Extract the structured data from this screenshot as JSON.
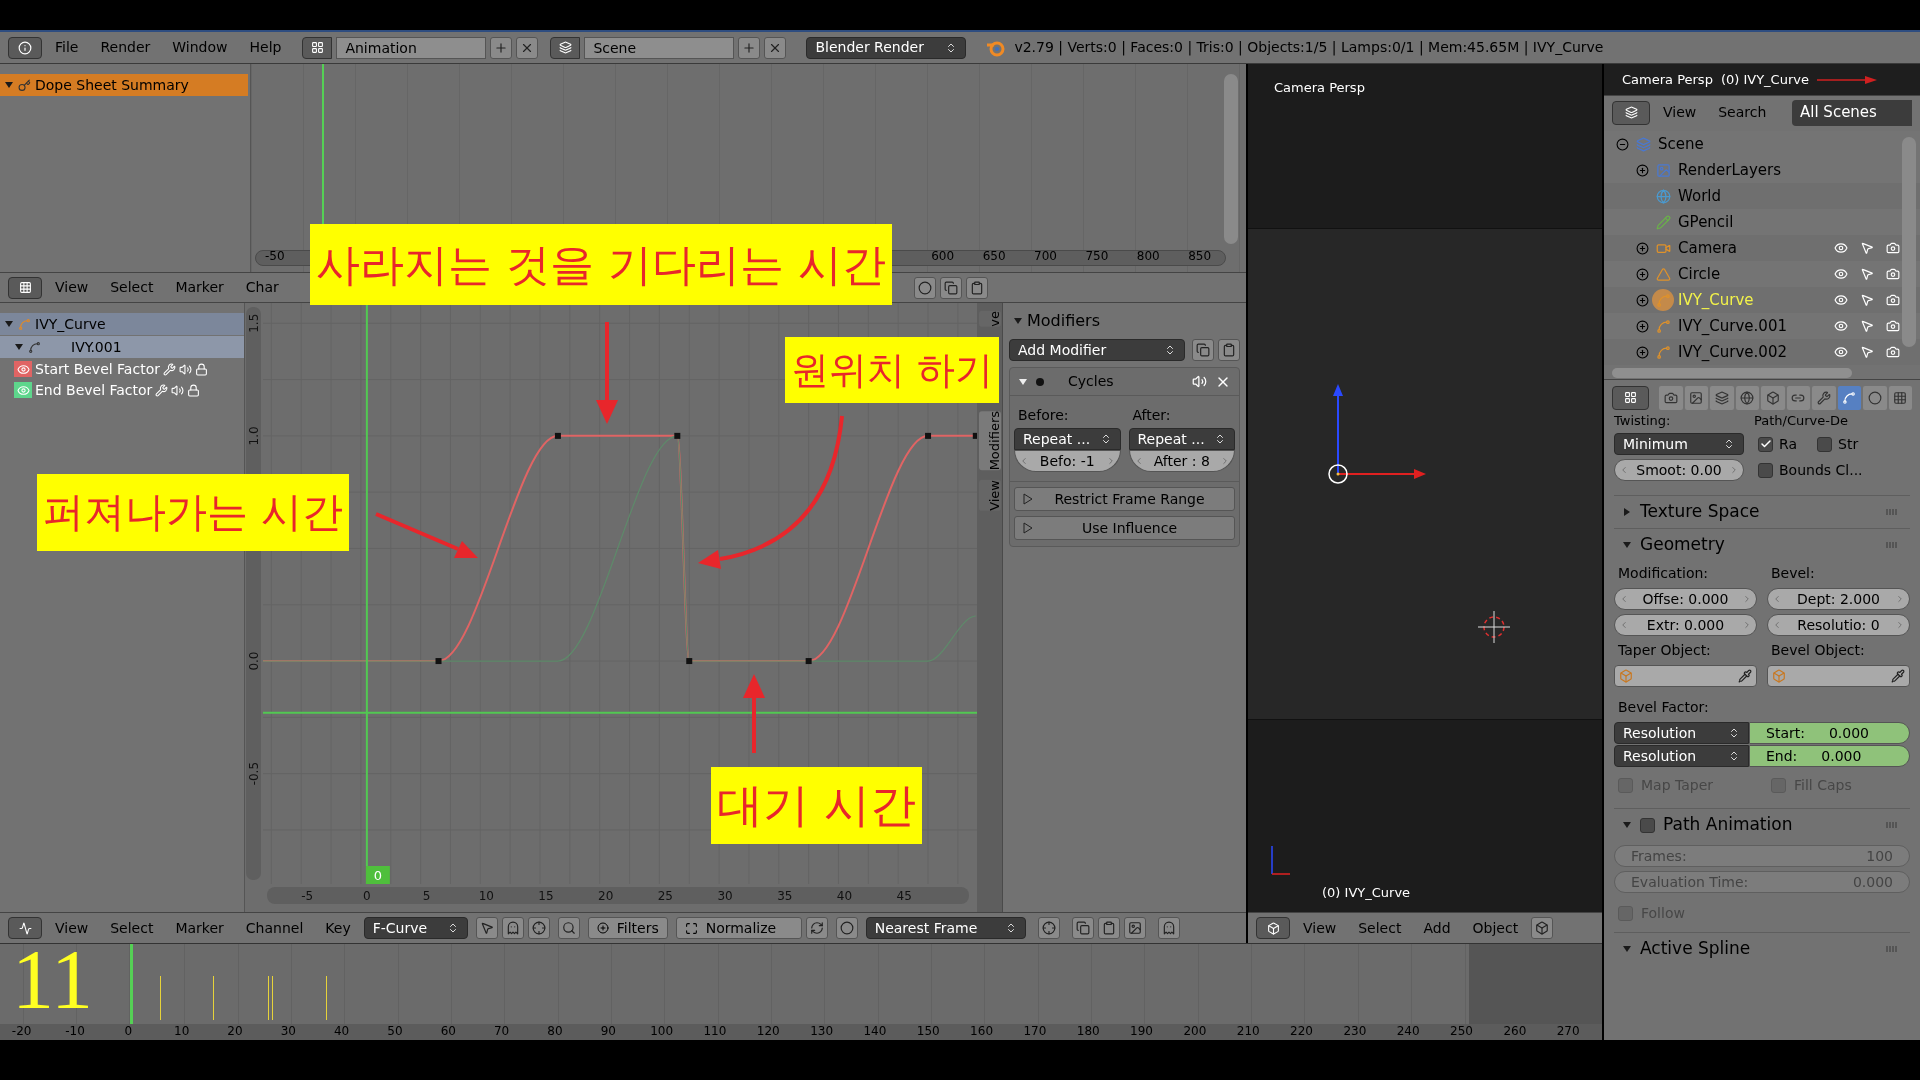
{
  "top_bar": {
    "menus": [
      "File",
      "Render",
      "Window",
      "Help"
    ],
    "layout": "Animation",
    "scene": "Scene",
    "engine": "Blender Render",
    "stats": "v2.79 | Verts:0 | Faces:0 | Tris:0 | Objects:1/5 | Lamps:0/1 | Mem:45.65M | IVY_Curve"
  },
  "dope_sheet": {
    "summary": "Dope Sheet Summary",
    "ruler_start": "-50",
    "ruler": [
      "600",
      "650",
      "700",
      "750",
      "800",
      "850"
    ],
    "menus": [
      "View",
      "Select",
      "Marker",
      "Char"
    ]
  },
  "graph_editor": {
    "channels": [
      {
        "kind": "object",
        "label": "IVY_Curve",
        "expanded": true
      },
      {
        "kind": "action",
        "label": "IVY.001",
        "expanded": true
      },
      {
        "kind": "fcurve",
        "label": "Start Bevel Factor",
        "color": "#e06464"
      },
      {
        "kind": "fcurve",
        "label": "End Bevel Factor",
        "color": "#5ed68c"
      }
    ],
    "chart_data": {
      "type": "line",
      "x": [
        -8.7,
        6,
        16,
        26,
        27,
        37,
        47,
        51
      ],
      "series": [
        {
          "color": "#e06464",
          "marker": true,
          "values": [
            0,
            0,
            1,
            1,
            0,
            0,
            1,
            1
          ]
        },
        {
          "color": "#5e8a6a",
          "values": [
            0,
            0,
            0,
            1,
            0,
            0,
            0,
            0.2
          ]
        }
      ],
      "xlim": [
        -8.7,
        51.1
      ],
      "ylim": [
        -0.99,
        1.59
      ],
      "grid": true,
      "xticks": [
        -5,
        0,
        5,
        10,
        15,
        20,
        25,
        30,
        35,
        40,
        45
      ],
      "yticks": [
        {
          "value": -0.5,
          "label": "-0.5"
        },
        {
          "value": 0,
          "label": "0.0"
        },
        {
          "value": 1,
          "label": "1.0"
        },
        {
          "value": 1.5,
          "label": "1.5"
        }
      ],
      "ref_lines": [
        {
          "axis": "y",
          "value": -0.23,
          "color": "#52c852"
        },
        {
          "axis": "x",
          "value": 0,
          "color": "#52c852",
          "label": "0"
        }
      ]
    },
    "side_tabs": [
      {
        "label": "ve",
        "selected": false
      },
      {
        "label": "Modifiers",
        "selected": true
      },
      {
        "label": "View",
        "selected": false
      }
    ],
    "modifiers": {
      "title": "Modifiers",
      "add": "Add Modifier",
      "cycles": {
        "name": "Cycles",
        "expanded": true,
        "before_label": "Before:",
        "after_label": "After:",
        "before_mode": "Repeat ...",
        "after_mode": "Repeat ...",
        "before_count": "Befo: -1",
        "after_count": "After : 8",
        "buttons": [
          "Restrict Frame Range",
          "Use Influence"
        ]
      }
    },
    "header": {
      "menus": [
        "View",
        "Select",
        "Marker",
        "Channel",
        "Key"
      ],
      "mode": "F-Curve",
      "filters": "Filters",
      "normalize": "Normalize",
      "snap": "Nearest Frame"
    }
  },
  "annotations": [
    {
      "text": "사라지는 것을 기다리는 시간"
    },
    {
      "text": "원위치 하기"
    },
    {
      "text": "퍼져나가는 시간"
    },
    {
      "text": "대기 시간"
    }
  ],
  "viewport": {
    "title": "Camera Persp",
    "object": "(0) IVY_Curve",
    "menus": [
      "View",
      "Select",
      "Add",
      "Object"
    ]
  },
  "timeline": {
    "frame_overlay": "11",
    "ruler": [
      "-20",
      "-10",
      "0",
      "10",
      "20",
      "30",
      "40",
      "50",
      "60",
      "70",
      "80",
      "90",
      "100",
      "110",
      "120",
      "130",
      "140",
      "150",
      "160",
      "170",
      "180",
      "190",
      "200",
      "210",
      "220",
      "230",
      "240",
      "250",
      "260",
      "270"
    ]
  },
  "outliner": {
    "strip_title": "Camera Persp",
    "strip_object": "(0) IVY_Curve",
    "menus": [
      "View",
      "Search"
    ],
    "filter": "All Scenes",
    "tree": [
      {
        "label": "Scene",
        "kind": "scene",
        "expandable": true,
        "expanded": true,
        "selected": false,
        "children": [
          {
            "label": "RenderLayers",
            "kind": "renderlayers",
            "expandable": true,
            "selected": false
          },
          {
            "label": "World",
            "kind": "world",
            "expandable": false,
            "selected": false
          },
          {
            "label": "GPencil",
            "kind": "gpencil",
            "expandable": false,
            "selected": false
          },
          {
            "label": "Camera",
            "kind": "camera",
            "expandable": true,
            "selected": false
          },
          {
            "label": "Circle",
            "kind": "mesh",
            "expandable": true,
            "selected": false
          },
          {
            "label": "IVY_Curve",
            "kind": "curve",
            "expandable": true,
            "selected": true
          },
          {
            "label": "IVY_Curve.001",
            "kind": "curve",
            "expandable": true,
            "selected": false
          },
          {
            "label": "IVY_Curve.002",
            "kind": "curve",
            "expandable": true,
            "selected": false
          }
        ]
      }
    ]
  },
  "properties": {
    "tabs": [
      {
        "kind": "render",
        "selected": false
      },
      {
        "kind": "layers",
        "selected": false
      },
      {
        "kind": "scene",
        "selected": false
      },
      {
        "kind": "world",
        "selected": false
      },
      {
        "kind": "object",
        "selected": false
      },
      {
        "kind": "constraints",
        "selected": false
      },
      {
        "kind": "modifiers",
        "selected": false
      },
      {
        "kind": "data",
        "selected": true
      },
      {
        "kind": "material",
        "selected": false
      },
      {
        "kind": "texture",
        "selected": false
      }
    ],
    "twisting_label": "Twisting:",
    "path_label": "Path/Curve-De",
    "twist_method": "Minimum",
    "smooth": "Smoot: 0.00",
    "checks": [
      {
        "label": "Ra",
        "checked": true
      },
      {
        "label": "Str",
        "checked": false
      },
      {
        "label": "Bounds Cl...",
        "checked": false
      }
    ],
    "texture_space": {
      "title": "Texture Space",
      "expanded": false
    },
    "geometry": {
      "title": "Geometry",
      "expanded": true,
      "modification_label": "Modification:",
      "bevel_label": "Bevel:",
      "fields": [
        "Offse: 0.000",
        "Dept: 2.000",
        "Extr:  0.000",
        "Resolutio:  0"
      ],
      "taper_label": "Taper Object:",
      "bevel_object_label": "Bevel Object:",
      "bevel_factor_label": "Bevel Factor:",
      "factors": [
        {
          "mapping": "Resolution",
          "label": "Start:",
          "value": "0.000",
          "animated": true
        },
        {
          "mapping": "Resolution",
          "label": "End:",
          "value": "0.000",
          "animated": true
        }
      ],
      "options": [
        {
          "label": "Map Taper",
          "checked": false,
          "disabled": true
        },
        {
          "label": "Fill Caps",
          "checked": false,
          "disabled": true
        }
      ]
    },
    "path_animation": {
      "title": "Path Animation",
      "expanded": true,
      "enabled": false,
      "fields": [
        {
          "label": "Frames:",
          "value": "100"
        },
        {
          "label": "Evaluation Time:",
          "value": "0.000"
        }
      ],
      "follow": {
        "label": "Follow",
        "checked": false
      }
    },
    "active_spline": {
      "title": "Active Spline",
      "expanded": true
    }
  }
}
